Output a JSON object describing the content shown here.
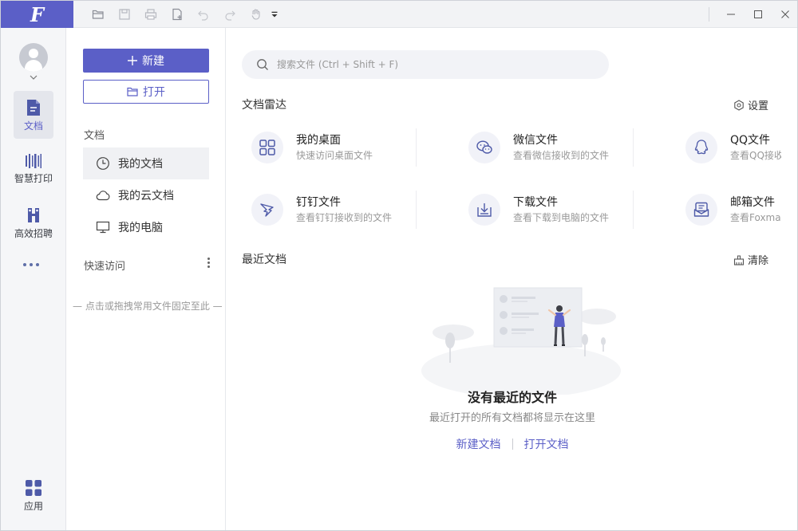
{
  "app": {
    "logo": "F"
  },
  "toolbar": {
    "icons": [
      "open-folder-icon",
      "save-icon",
      "print-icon",
      "new-file-icon",
      "undo-icon",
      "redo-icon",
      "hand-tool-icon",
      "customize-dropdown-icon"
    ]
  },
  "rail": {
    "items": [
      {
        "label": "文档",
        "icon": "document-icon",
        "active": true
      },
      {
        "label": "智慧打印",
        "icon": "smart-print-icon"
      },
      {
        "label": "高效招聘",
        "icon": "recruit-icon"
      },
      {
        "label": "应用",
        "icon": "apps-grid-icon"
      }
    ]
  },
  "nav": {
    "new_label": "新建",
    "open_label": "打开",
    "docs_section": "文档",
    "items": [
      {
        "label": "我的文档",
        "icon": "clock-icon",
        "active": true
      },
      {
        "label": "我的云文档",
        "icon": "cloud-icon"
      },
      {
        "label": "我的电脑",
        "icon": "monitor-icon"
      }
    ],
    "quick_access": "快速访问",
    "pin_hint": "点击或拖拽常用文件固定至此"
  },
  "main": {
    "search_placeholder": "搜索文件 (Ctrl + Shift + F)",
    "radar_title": "文档雷达",
    "settings_label": "设置",
    "radar_cards": [
      {
        "title": "我的桌面",
        "desc": "快速访问桌面文件",
        "icon": "desktop-grid-icon"
      },
      {
        "title": "微信文件",
        "desc": "查看微信接收到的文件",
        "icon": "wechat-icon"
      },
      {
        "title": "QQ文件",
        "desc": "查看QQ接收",
        "icon": "qq-icon"
      },
      {
        "title": "钉钉文件",
        "desc": "查看钉钉接收到的文件",
        "icon": "dingtalk-icon"
      },
      {
        "title": "下载文件",
        "desc": "查看下载到电脑的文件",
        "icon": "download-icon"
      },
      {
        "title": "邮箱文件",
        "desc": "查看Foxmai",
        "icon": "mailbox-icon"
      }
    ],
    "recent_title": "最近文档",
    "clear_label": "清除",
    "empty_title": "没有最近的文件",
    "empty_sub": "最近打开的所有文档都将显示在这里",
    "new_doc_link": "新建文档",
    "open_doc_link": "打开文档"
  },
  "colors": {
    "accent": "#5b5fc7",
    "rail_bg": "#f5f6f8",
    "icon_blue": "#4e5aa8"
  }
}
